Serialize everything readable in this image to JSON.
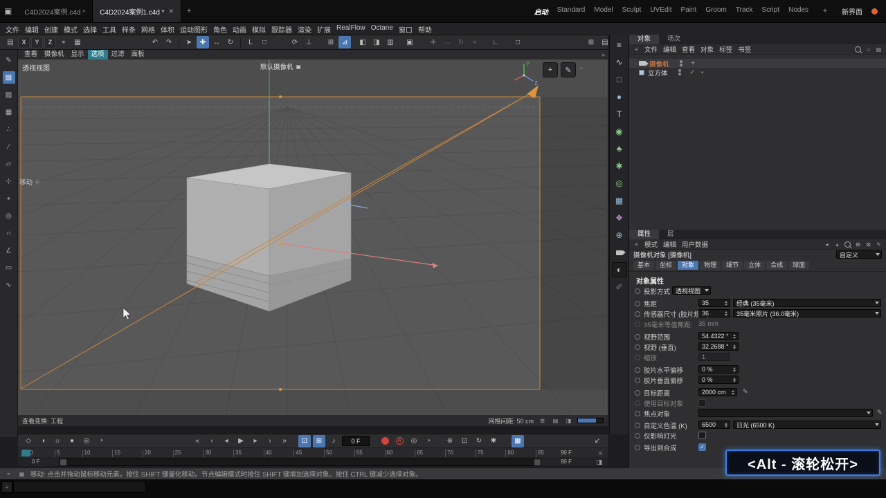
{
  "colors": {
    "accent": "#4a76b1",
    "teal": "#2f7d8c",
    "sel-orange": "#ff8b3d",
    "green": "#6fce6f",
    "red": "#d04444",
    "overlay-blue": "#3f7de0"
  },
  "titlebar": {
    "tabs": [
      {
        "label": "C4D2024案例.c4d *"
      },
      {
        "label": "C4D2024案例1.c4d *"
      }
    ],
    "layouts": [
      "启动",
      "Standard",
      "Model",
      "Sculpt",
      "UVEdit",
      "Paint",
      "Groom",
      "Track",
      "Script",
      "Nodes"
    ],
    "new_ui": "新界面"
  },
  "menubar": {
    "items": [
      "文件",
      "编辑",
      "创建",
      "模式",
      "选择",
      "工具",
      "样条",
      "网格",
      "体积",
      "运动图形",
      "角色",
      "动画",
      "模拟",
      "跟踪器",
      "渲染",
      "扩展",
      "RealFlow",
      "Octane",
      "窗口",
      "帮助"
    ]
  },
  "viewport": {
    "menu": [
      "查看",
      "摄像机",
      "显示",
      "选项",
      "过滤",
      "面板"
    ],
    "view_label": "透视视图",
    "camera_label": "默认摄像机",
    "tool_hint": "移动",
    "axis": {
      "y": "Y",
      "z": "Z"
    },
    "footer_left": "查看变换: 工程",
    "footer_right": "网格间距: 50 cm"
  },
  "object_manager": {
    "tabs": [
      "对象",
      "场次"
    ],
    "menu": [
      "文件",
      "编辑",
      "查看",
      "对象",
      "标签",
      "书签"
    ],
    "items": [
      {
        "name": "摄像机"
      },
      {
        "name": "立方体"
      }
    ]
  },
  "attributes": {
    "tabs": [
      "属性",
      "层"
    ],
    "menu": [
      "模式",
      "编辑",
      "用户数据"
    ],
    "title": "摄像机对象 [摄像机]",
    "preset": "自定义",
    "section_tabs": [
      "基本",
      "坐标",
      "对象",
      "物理",
      "细节",
      "立体",
      "合成",
      "球面"
    ],
    "section": "对象属性",
    "rows": {
      "projection": {
        "label": "投影方式",
        "value": "透视视图"
      },
      "focal": {
        "label": "焦距",
        "value": "35",
        "preset": "经典 (35毫米)"
      },
      "sensor": {
        "label": "传感器尺寸 (胶片规格)",
        "value": "36",
        "preset": "35毫米照片 (36.0毫米)"
      },
      "equiv": {
        "label": "35毫米等值焦距:",
        "value": "35 mm"
      },
      "fov": {
        "label": "视野范围",
        "value": "54.4322 °"
      },
      "fov_v": {
        "label": "视野 (垂直)",
        "value": "32.2688 °"
      },
      "zoom": {
        "label": "缩放",
        "value": "1"
      },
      "film_h": {
        "label": "胶片水平偏移",
        "value": "0 %"
      },
      "film_v": {
        "label": "胶片垂直偏移",
        "value": "0 %"
      },
      "target": {
        "label": "目标距离",
        "value": "2000 cm"
      },
      "use_target": {
        "label": "使用目标对象"
      },
      "focus": {
        "label": "焦点对象"
      },
      "temp": {
        "label": "自定义色温 (K)",
        "value": "6500",
        "preset": "日光 (6500 K)"
      },
      "lights_only": {
        "label": "仅影响灯光"
      },
      "export_comp": {
        "label": "导出到合成"
      }
    }
  },
  "timeline": {
    "ticks": [
      "0",
      "5",
      "10",
      "15",
      "20",
      "25",
      "30",
      "35",
      "40",
      "45",
      "50",
      "55",
      "60",
      "65",
      "70",
      "75",
      "80",
      "85"
    ],
    "end_label": "90 F",
    "frame_field": "0 F",
    "range_start": "0 F",
    "range_end": "90 F"
  },
  "status": "移动: 点击并拖动鼠标移动元素。按住 SHIFT 键量化移动。节点编辑模式时按住 SHIFT 键增加选择对象。按住 CTRL 键减少选择对象。",
  "overlay": {
    "text": "<Alt - 滚轮松开>"
  },
  "icons": {
    "logo": "▣",
    "close": "✕",
    "plus": "+",
    "menu": "≡",
    "chevrons": "»",
    "caret_up": "⌃",
    "save": "▤",
    "undo": "↶",
    "redo": "↷",
    "select": "➤",
    "move": "✚",
    "scale": "↔",
    "rotate": "↻",
    "coord": "⌖",
    "workplane": "▦",
    "axis_l": "L",
    "anchor": "⊥",
    "refresh": "⟳",
    "grid": "⊞",
    "snap": "⊿",
    "render_view": "◧",
    "render_region": "◨",
    "render_settings": "▥",
    "team_render": "▣",
    "measure": "∟",
    "cube_outline": "□",
    "x": "X",
    "y": "Y",
    "z": "Z",
    "home": "⌂",
    "panel": "▤",
    "back": "◂",
    "up": "▴",
    "lock": "⊠",
    "pen": "✎",
    "check": "✓",
    "target": "⌖",
    "tag": "▪",
    "lt_convert": "✎",
    "lt_model": "▧",
    "lt_texture": "▨",
    "lt_workplane": "▦",
    "lt_point": "∴",
    "lt_edge": "∕",
    "lt_poly": "▱",
    "lt_tweak": "⊹",
    "lt_axis": "⌖",
    "lt_solo": "◎",
    "lt_snap": "∩",
    "lt_quant": "∠",
    "lt_lock": "▭",
    "lt_spline": "∿",
    "pal_spline": "∿",
    "pal_cube": "□",
    "pal_sphere": "●",
    "pal_text": "T",
    "pal_light": "◉",
    "pal_tree": "♣",
    "pal_gear": "✱",
    "pal_field": "◎",
    "pal_volume": "▦",
    "pal_mograph": "❖",
    "pal_globe": "⊕",
    "pal_material": "◐",
    "pal_brush": "✐",
    "an_key": "◇",
    "an_half": "◑",
    "an_sun": "☼",
    "an_ball": "●",
    "an_ring": "◎",
    "an_pie": "◔",
    "pb_start": "«",
    "pb_prevkey": "‹",
    "pb_prev": "◂",
    "pb_play": "▶",
    "pb_next": "▸",
    "pb_nextkey": "›",
    "pb_end": "»",
    "pla": "⊡",
    "frame_all": "⊞",
    "sound": "♪",
    "rec_a": "A",
    "key_sel": "◎",
    "clock": "◔",
    "rec_pos": "⊕",
    "rec_scale": "⊡",
    "rec_rot": "↻",
    "rec_param": "✱",
    "key_preset": "▦",
    "fcurve": "↙",
    "opts": "≡",
    "split": "◨",
    "status_grid": "▦",
    "status_wave": "≈"
  }
}
